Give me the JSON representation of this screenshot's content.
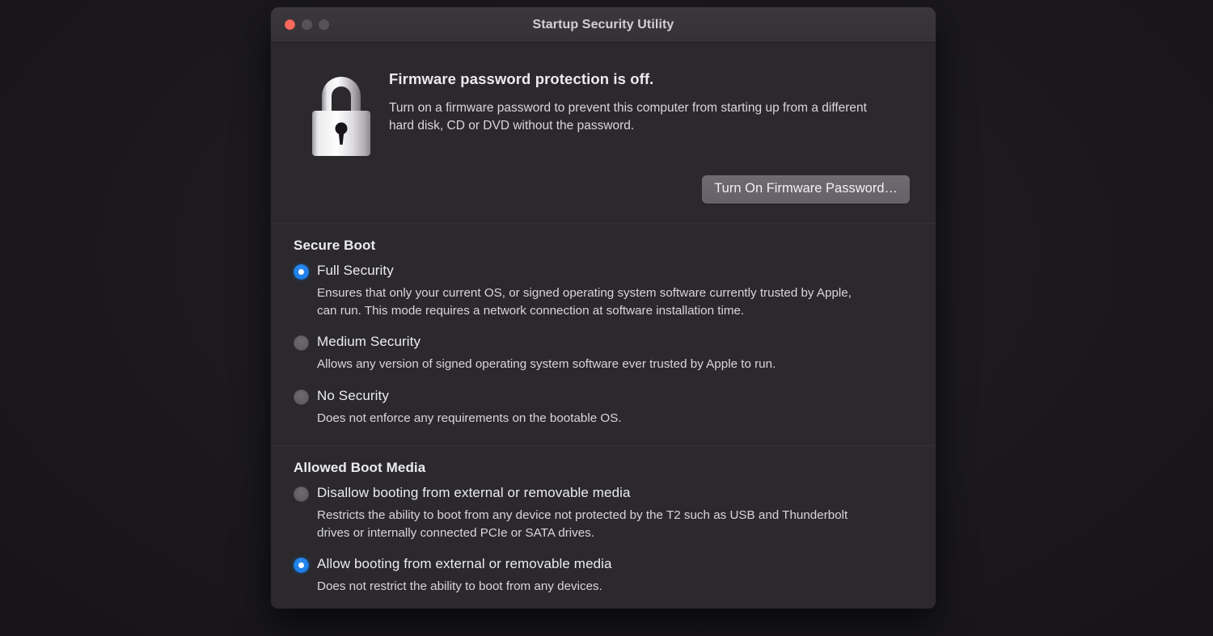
{
  "window": {
    "title": "Startup Security Utility",
    "traffic_lights": [
      {
        "name": "close",
        "color": "#f9695d"
      },
      {
        "name": "minimize",
        "color": "#555357"
      },
      {
        "name": "maximize",
        "color": "#555357"
      }
    ]
  },
  "firmware": {
    "icon": "padlock-icon",
    "heading": "Firmware password protection is off.",
    "description": "Turn on a firmware password to prevent this computer from starting up from a different hard disk, CD or DVD without the password.",
    "button_label": "Turn On Firmware Password…"
  },
  "secure_boot": {
    "title": "Secure Boot",
    "options": [
      {
        "label": "Full Security",
        "selected": true,
        "description": "Ensures that only your current OS, or signed operating system software currently trusted by Apple, can run. This mode requires a network connection at software installation time."
      },
      {
        "label": "Medium Security",
        "selected": false,
        "description": "Allows any version of signed operating system software ever trusted by Apple to run."
      },
      {
        "label": "No Security",
        "selected": false,
        "description": "Does not enforce any requirements on the bootable OS."
      }
    ]
  },
  "allowed_boot_media": {
    "title": "Allowed Boot Media",
    "options": [
      {
        "label": "Disallow booting from external or removable media",
        "selected": false,
        "description": "Restricts the ability to boot from any device not protected by the T2 such as USB and Thunderbolt drives or internally connected PCIe or SATA drives."
      },
      {
        "label": "Allow booting from external or removable media",
        "selected": true,
        "description": "Does not restrict the ability to boot from any devices."
      }
    ]
  },
  "colors": {
    "accent": "#1c7de4",
    "window_bg": "#2b292c",
    "titlebar_bg": "#37353a",
    "close_red": "#f9695d",
    "text_primary": "#ecebed",
    "text_secondary": "#d8d6d9"
  }
}
